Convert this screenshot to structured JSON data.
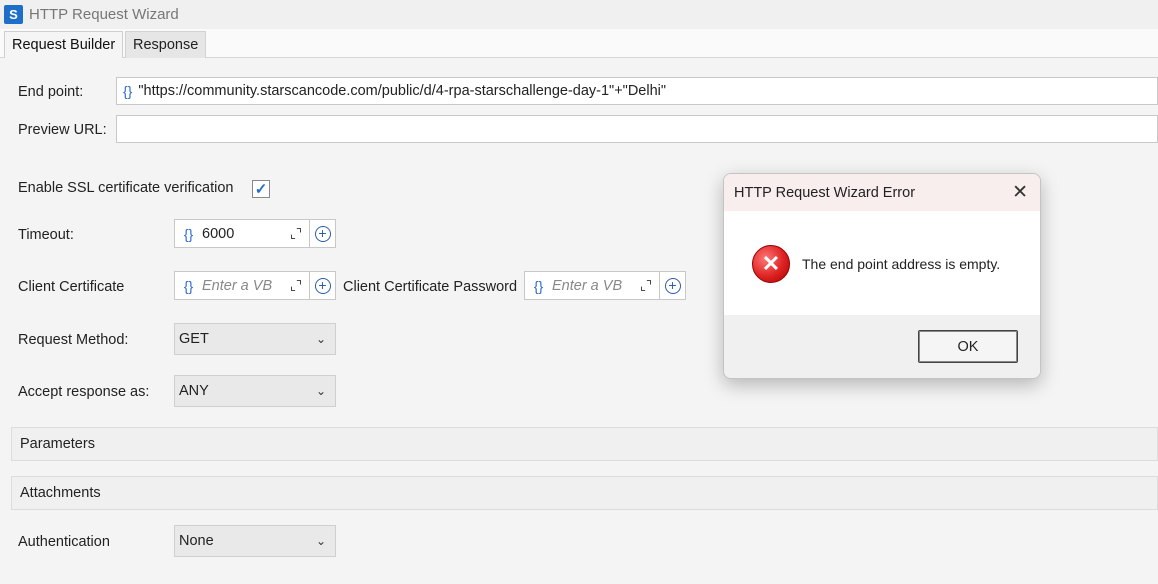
{
  "window": {
    "app_icon_glyph": "S",
    "title": "HTTP Request Wizard"
  },
  "tabs": [
    {
      "label": "Request Builder",
      "active": true
    },
    {
      "label": "Response",
      "active": false
    }
  ],
  "form": {
    "endpoint_label": "End point:",
    "endpoint_brace": "{}",
    "endpoint_value": "\"https://community.starscancode.com/public/d/4-rpa-starschallenge-day-1\"+\"Delhi\"",
    "preview_label": "Preview URL:",
    "preview_value": "",
    "ssl_label": "Enable SSL certificate verification",
    "ssl_checked": true,
    "timeout_label": "Timeout:",
    "timeout_value": "6000",
    "client_cert_label": "Client Certificate",
    "client_cert_placeholder": "Enter a VB",
    "client_cert_pw_label": "Client Certificate Password",
    "client_cert_pw_placeholder": "Enter a VB",
    "method_label": "Request Method:",
    "method_value": "GET",
    "accept_label": "Accept response as:",
    "accept_value": "ANY",
    "auth_label": "Authentication",
    "auth_value": "None"
  },
  "sections": {
    "parameters": "Parameters",
    "attachments": "Attachments"
  },
  "icons": {
    "brace": "{}",
    "expand": "⌞⌝",
    "plus": "+",
    "chevron": "⌄",
    "check": "✓"
  },
  "dialog": {
    "title": "HTTP Request Wizard Error",
    "close_glyph": "✕",
    "message": "The end point address is empty.",
    "ok_label": "OK",
    "error_glyph": "✕"
  },
  "colors": {
    "accent": "#1e6fc8",
    "brace": "#2a6ad1",
    "error": "#d22222"
  }
}
